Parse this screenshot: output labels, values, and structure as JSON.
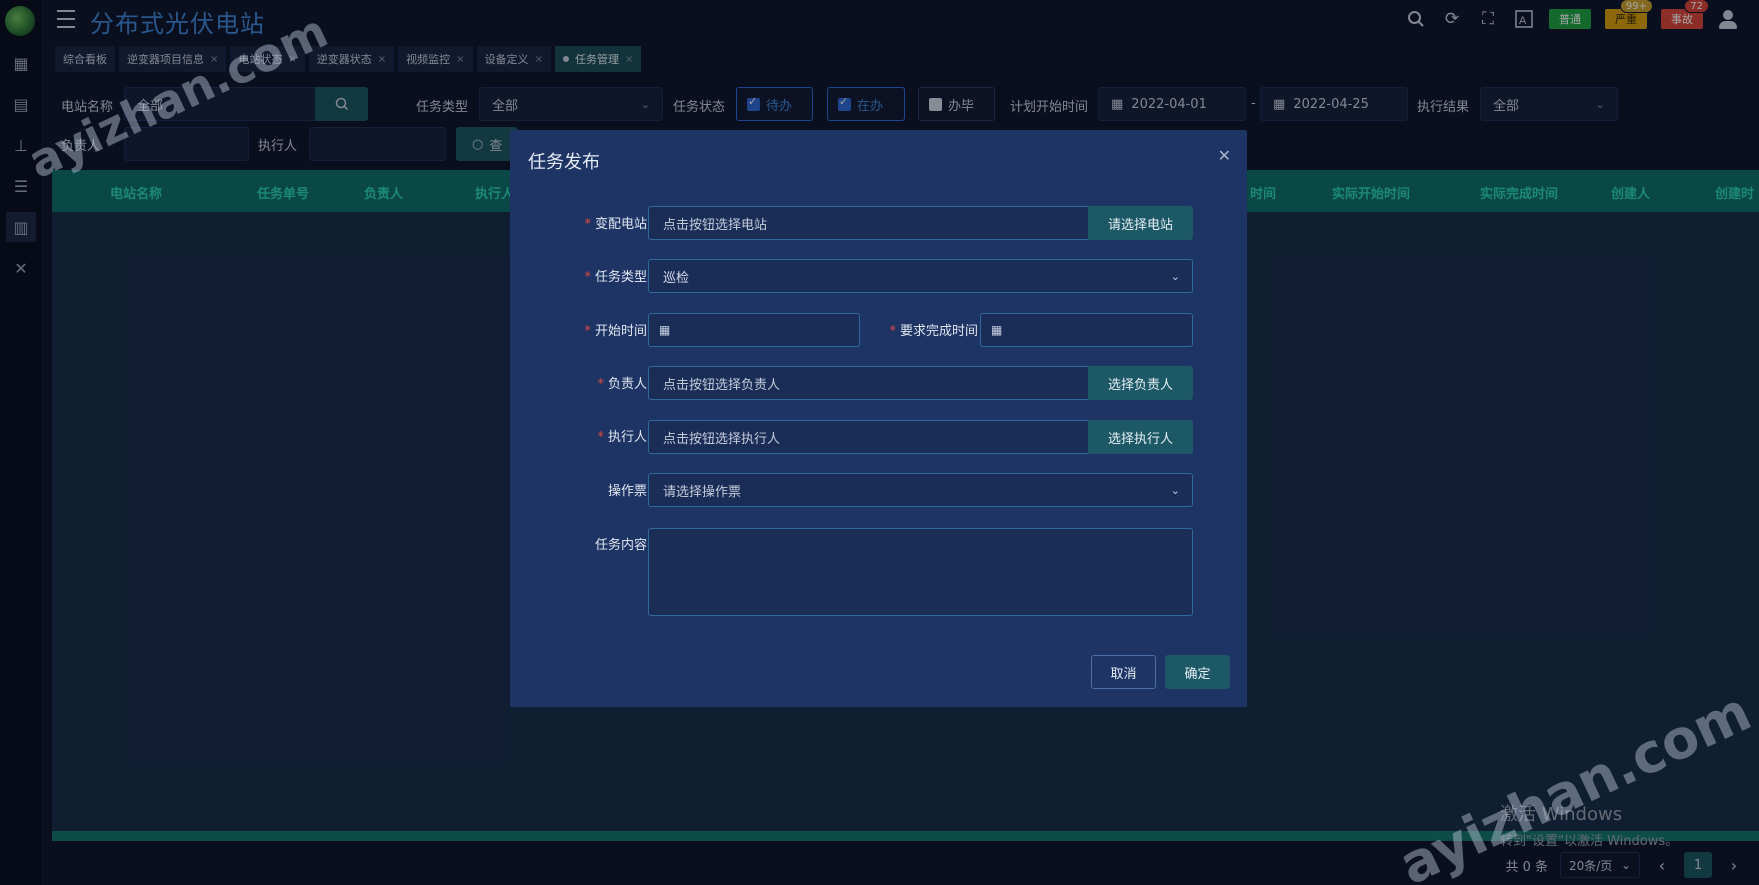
{
  "app": {
    "title": "分布式光伏电站"
  },
  "header": {
    "badges": [
      {
        "label": "普通",
        "count": ""
      },
      {
        "label": "严重",
        "count": "99+"
      },
      {
        "label": "事故",
        "count": "72"
      }
    ],
    "icons": [
      "search-icon",
      "refresh-icon",
      "fullscreen-icon",
      "font-size-icon",
      "user-icon"
    ]
  },
  "tabs": [
    {
      "label": "综合看板",
      "closable": false
    },
    {
      "label": "逆变器项目信息",
      "closable": true
    },
    {
      "label": "电站状态",
      "closable": true
    },
    {
      "label": "逆变器状态",
      "closable": true
    },
    {
      "label": "视频监控",
      "closable": true
    },
    {
      "label": "设备定义",
      "closable": true
    },
    {
      "label": "任务管理",
      "closable": true,
      "active": true
    }
  ],
  "filters": {
    "station_label": "电站名称",
    "station_value": "全部",
    "task_type_label": "任务类型",
    "task_type_value": "全部",
    "task_status_label": "任务状态",
    "status_options": [
      {
        "label": "待办",
        "checked": true
      },
      {
        "label": "在办",
        "checked": true
      },
      {
        "label": "办毕",
        "checked": false
      }
    ],
    "plan_start_label": "计划开始时间",
    "date_from": "2022-04-01",
    "date_sep": "-",
    "date_to": "2022-04-25",
    "result_label": "执行结果",
    "result_value": "全部",
    "owner_label": "负责人",
    "executor_label": "执行人",
    "query_label": "查"
  },
  "table": {
    "headers_left": [
      "电站名称",
      "任务单号",
      "负责人",
      "执行人"
    ],
    "headers_right": [
      "时间",
      "实际开始时间",
      "实际完成时间",
      "创建人",
      "创建时"
    ]
  },
  "pagination": {
    "total": "共 0 条",
    "page_size": "20条/页",
    "current_page": "1"
  },
  "windows_activation": {
    "line1": "激活 Windows",
    "line2": "转到\"设置\"以激活 Windows。"
  },
  "watermark": "ayizhan.com",
  "modal": {
    "title": "任务发布",
    "fields": {
      "station_label": "变配电站",
      "station_placeholder": "点击按钮选择电站",
      "station_button": "请选择电站",
      "task_type_label": "任务类型",
      "task_type_value": "巡检",
      "start_time_label": "开始时间",
      "due_time_label": "要求完成时间",
      "owner_label": "负责人",
      "owner_placeholder": "点击按钮选择负责人",
      "owner_button": "选择负责人",
      "executor_label": "执行人",
      "executor_placeholder": "点击按钮选择执行人",
      "executor_button": "选择执行人",
      "ticket_label": "操作票",
      "ticket_placeholder": "请选择操作票",
      "content_label": "任务内容"
    },
    "cancel_label": "取消",
    "ok_label": "确定"
  }
}
